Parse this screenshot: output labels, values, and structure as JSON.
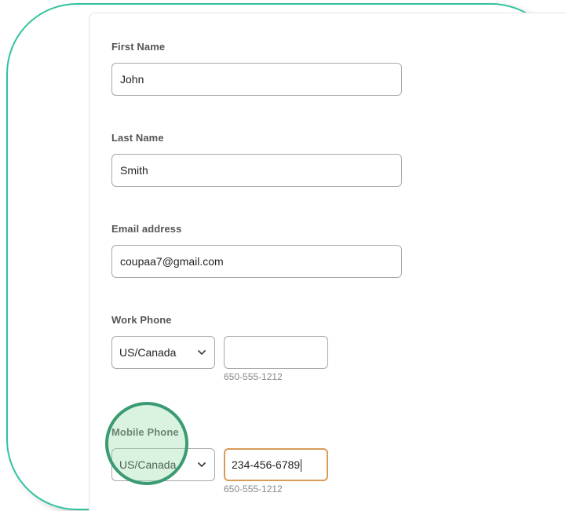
{
  "form": {
    "first_name": {
      "label": "First Name",
      "value": "John"
    },
    "last_name": {
      "label": "Last Name",
      "value": "Smith"
    },
    "email": {
      "label": "Email address",
      "value": "coupaa7@gmail.com"
    },
    "work_phone": {
      "label": "Work Phone",
      "country": "US/Canada",
      "number": "",
      "hint": "650-555-1212"
    },
    "mobile_phone": {
      "label": "Mobile Phone",
      "country": "US/Canada",
      "number": "234-456-6789",
      "hint": "650-555-1212"
    }
  },
  "icons": {
    "select_chevron": "chevron-down-icon"
  },
  "colors": {
    "frame_border": "#2fc39f",
    "focus_border": "#d99b5a",
    "highlight_circle": "#3a9b72",
    "highlight_fill": "#96dcaa"
  }
}
